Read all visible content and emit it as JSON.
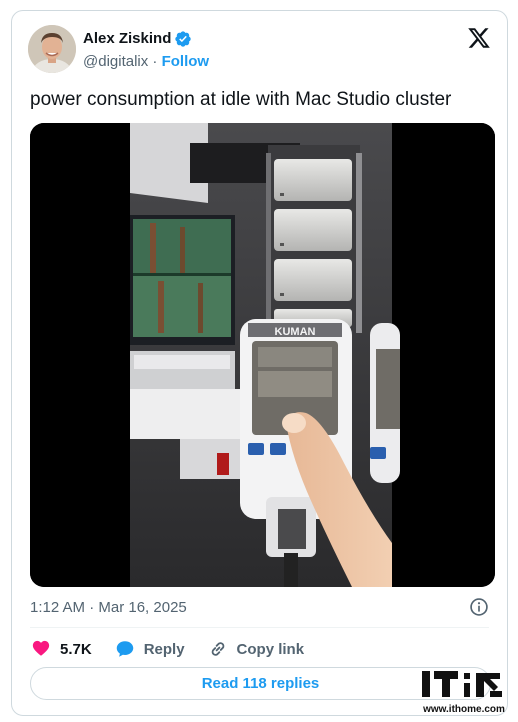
{
  "author": {
    "display_name": "Alex Ziskind",
    "handle": "@digitalix",
    "separator": " · ",
    "follow_label": "Follow"
  },
  "tweet": {
    "text": "power consumption at idle with Mac Studio cluster",
    "timestamp": "1:12 AM · Mar 16, 2025",
    "media": {
      "meter_brand": "KUMAN"
    }
  },
  "actions": {
    "likes_count": "5.7K",
    "reply_label": "Reply",
    "copy_link_label": "Copy link",
    "read_replies_label": "Read 118 replies"
  },
  "colors": {
    "accent": "#1d9bf0",
    "like": "#f91880",
    "muted": "#536471"
  },
  "icons": {
    "verified": "verified-badge-icon",
    "platform": "x-logo-icon",
    "info": "info-icon",
    "like": "heart-icon",
    "reply": "speech-bubble-icon",
    "copy_link": "link-icon"
  },
  "watermark": {
    "url": "www.ithome.com"
  }
}
